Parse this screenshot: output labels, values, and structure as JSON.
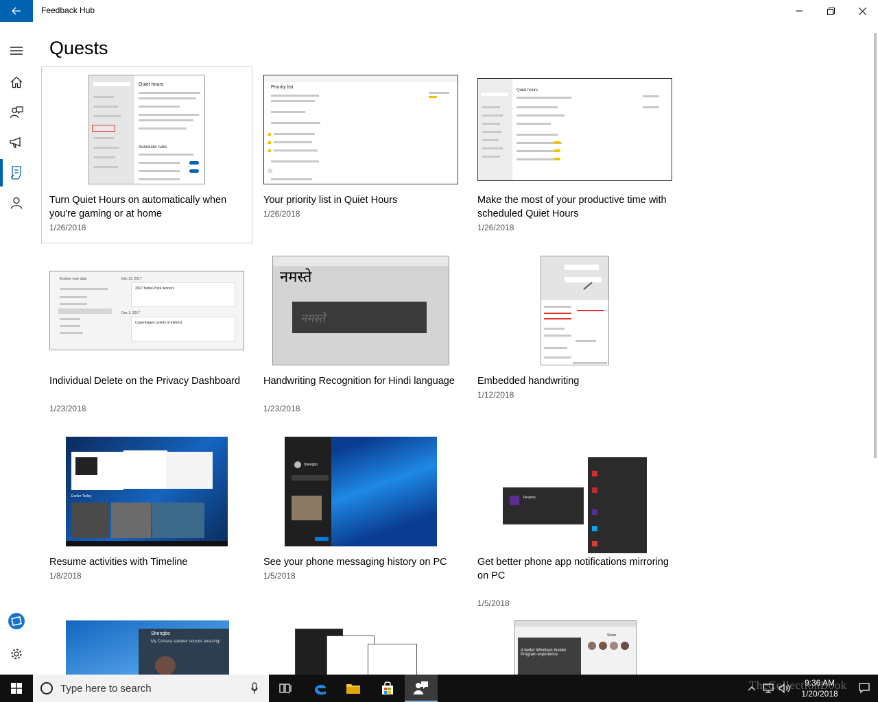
{
  "window": {
    "title": "Feedback Hub",
    "accent": "#0063b1"
  },
  "sidebar": {
    "items": [
      {
        "name": "menu",
        "icon": "hamburger-icon"
      },
      {
        "name": "home",
        "icon": "home-icon"
      },
      {
        "name": "feedback",
        "icon": "feedback-icon"
      },
      {
        "name": "announcements",
        "icon": "megaphone-icon"
      },
      {
        "name": "quests",
        "icon": "quests-icon",
        "active": true
      },
      {
        "name": "achievements",
        "icon": "person-icon"
      }
    ],
    "bottom": [
      {
        "name": "insider",
        "icon": "insider-icon"
      },
      {
        "name": "settings",
        "icon": "gear-icon"
      }
    ]
  },
  "page": {
    "title": "Quests"
  },
  "quests": [
    {
      "title": "Turn Quiet Hours on automatically when you're gaming or at home",
      "date": "1/26/2018"
    },
    {
      "title": "Your priority list in Quiet Hours",
      "date": "1/26/2018"
    },
    {
      "title": "Make the most of your productive time with scheduled Quiet Hours",
      "date": "1/26/2018"
    },
    {
      "title": "Individual Delete on the Privacy Dashboard",
      "date": "1/23/2018"
    },
    {
      "title": "Handwriting Recognition for Hindi language",
      "date": "1/23/2018"
    },
    {
      "title": "Embedded handwriting",
      "date": "1/12/2018"
    },
    {
      "title": "Resume activities with Timeline",
      "date": "1/8/2018"
    },
    {
      "title": "See your phone messaging history on PC",
      "date": "1/5/2018"
    },
    {
      "title": "Get better phone app notifications mirroring on PC",
      "date": "1/5/2018"
    }
  ],
  "thumb_text": {
    "quiet_hours": "Quiet hours",
    "priority_list": "Priority list",
    "automatic_rules": "Automatic rules",
    "privacy_header": "Explore your data",
    "privacy_date1": "Dec 13, 2017",
    "privacy_item1": "2017 Nobel Prize winners",
    "privacy_date2": "Dec 1, 2017",
    "privacy_item2": "Copenhagen: points of interest",
    "hindi_word": "नमस्ते",
    "timeline_heading": "Earlier Today",
    "sms_name": "Shengbo",
    "cortana_name": "Shengbo",
    "cortana_msg": "My Cortana speaker sounds amazing!",
    "notif_app": "Finance",
    "browser_promo": "A better Windows Insider Program experience",
    "browser_share": "Share"
  },
  "taskbar": {
    "search_placeholder": "Type here to search",
    "time": "9:36 AM",
    "date": "1/20/2018",
    "watermark": "TheCollectionBook"
  }
}
